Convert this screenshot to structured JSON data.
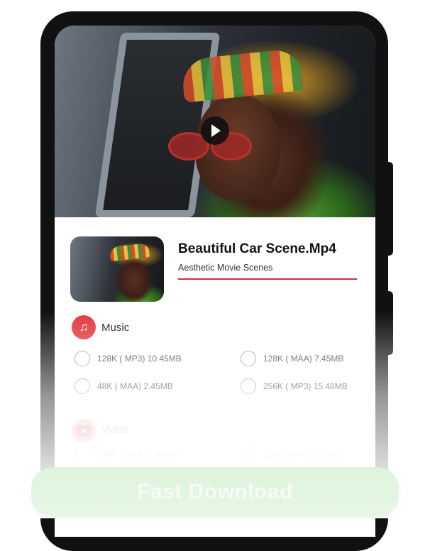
{
  "media": {
    "title": "Beautiful Car Scene.Mp4",
    "subtitle": "Aesthetic Movie Scenes"
  },
  "music": {
    "label": "Music",
    "options": [
      "128K ( MP3) 10.45MB",
      "128K ( MAA) 7.45MB",
      "48K ( MAA) 2.45MB",
      "256K ( MP3) 15.48MB"
    ]
  },
  "video": {
    "label": "Video",
    "options": [
      "144P ( MAA) 1.45MB",
      "128P ( MP3) 3.25MB"
    ]
  },
  "cta": {
    "label": "Fast Download"
  },
  "colors": {
    "accent": "#e23a3f",
    "cta_bg": "#ddf3dd"
  }
}
